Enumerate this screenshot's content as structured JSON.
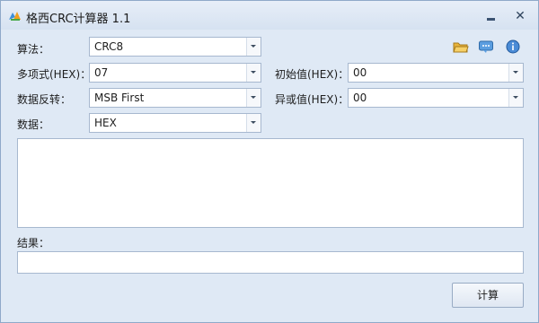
{
  "window": {
    "title": "格西CRC计算器 1.1",
    "minimize_glyph": "",
    "close_glyph": "✕"
  },
  "form": {
    "algorithm": {
      "label": "算法：",
      "value": "CRC8"
    },
    "polynomial": {
      "label": "多项式(HEX)：",
      "value": "07"
    },
    "initial": {
      "label": "初始值(HEX)：",
      "value": "00"
    },
    "reflect": {
      "label": "数据反转：",
      "value": "MSB First"
    },
    "xor": {
      "label": "异或值(HEX)：",
      "value": "00"
    },
    "data_format": {
      "label": "数据：",
      "value": "HEX"
    }
  },
  "data_input": {
    "value": ""
  },
  "result": {
    "label": "结果：",
    "value": ""
  },
  "calc_button": {
    "label": "计算"
  },
  "toolbar": {
    "icons": [
      "open-folder-icon",
      "message-icon",
      "info-icon"
    ]
  }
}
